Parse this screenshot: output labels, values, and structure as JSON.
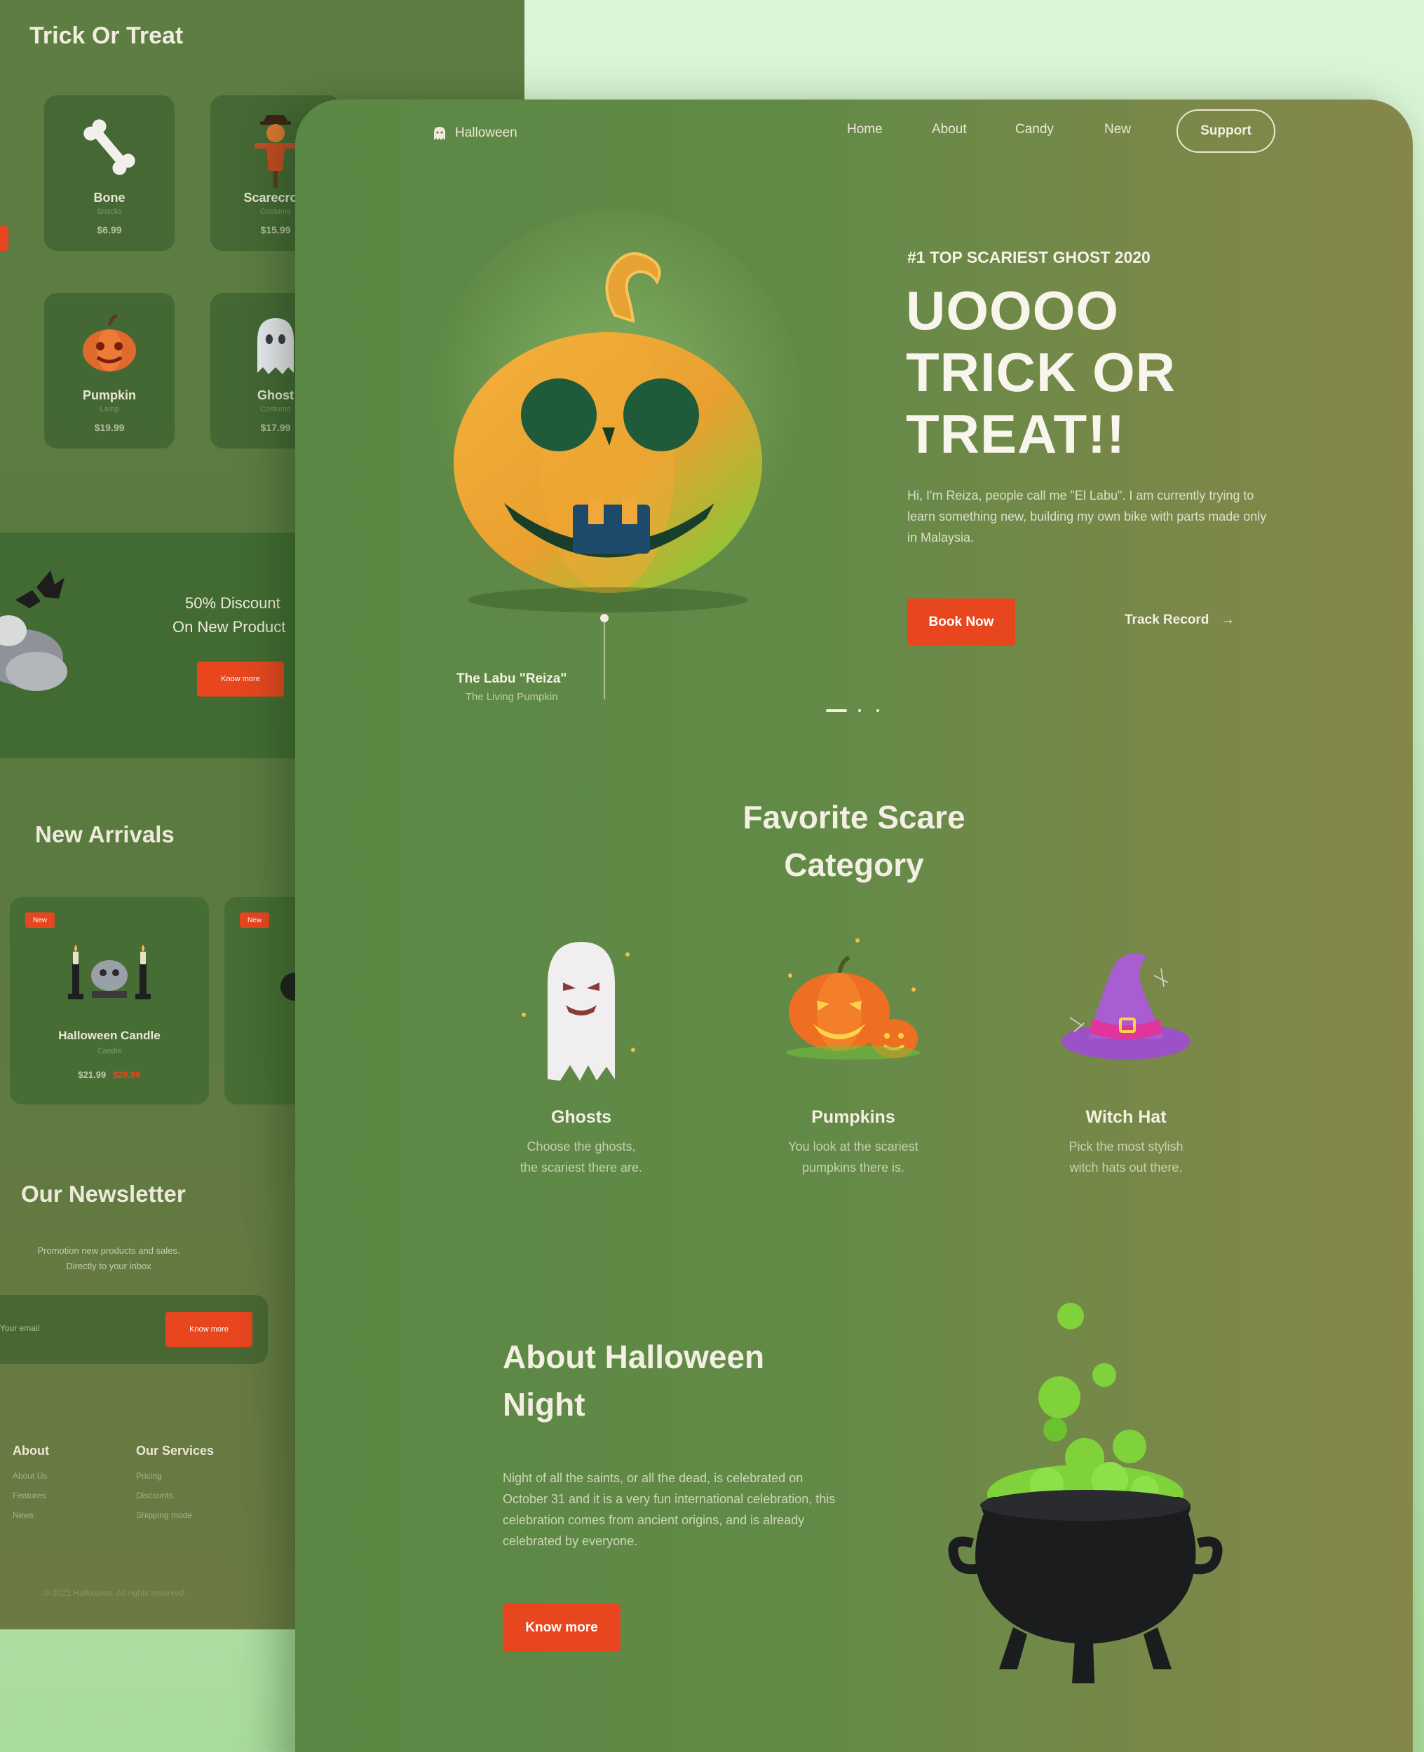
{
  "back_page": {
    "title": "Trick Or Treat",
    "products": [
      {
        "name": "Bone",
        "sub": "Snacks",
        "price": "$6.99",
        "icon": "bone-icon"
      },
      {
        "name": "Scarecrow",
        "sub": "Costume",
        "price": "$15.99",
        "icon": "scarecrow-icon"
      },
      {
        "name": "Pumpkin",
        "sub": "Lamp",
        "price": "$19.99",
        "icon": "pumpkin-icon"
      },
      {
        "name": "Ghost",
        "sub": "Costume",
        "price": "$17.99",
        "icon": "ghost-icon"
      }
    ],
    "promo": {
      "line1": "50% Discount",
      "line2": "On New Product",
      "button": "Know more"
    },
    "new_arrivals": {
      "title": "New Arrivals",
      "items": [
        {
          "tag": "New",
          "name": "Halloween Candle",
          "sub": "Candle",
          "price": "$21.99",
          "old_price": "$29.99"
        },
        {
          "tag": "New",
          "name": "",
          "sub": "",
          "price": "",
          "old_price": ""
        }
      ]
    },
    "newsletter": {
      "title": "Our Newsletter",
      "sub_line1": "Promotion new products and sales.",
      "sub_line2": "Directly to your inbox",
      "placeholder": "Your email",
      "button": "Know more"
    },
    "footer": {
      "col1": {
        "heading": "About",
        "items": [
          "About Us",
          "Features",
          "News"
        ]
      },
      "col2": {
        "heading": "Our Services",
        "items": [
          "Pricing",
          "Discounts",
          "Shipping mode"
        ]
      },
      "copyright": "© 2021 Halloween. All rights reserved."
    }
  },
  "front_page": {
    "logo": "Halloween",
    "nav": [
      "Home",
      "About",
      "Candy",
      "New"
    ],
    "support": "Support",
    "hero": {
      "tag": "#1 TOP SCARIEST GHOST 2020",
      "line1": "UOOOO",
      "line2": "TRICK OR",
      "line3": "TREAT!!",
      "desc": "Hi, I'm Reiza, people call me \"El Labu\". I am currently trying to learn something new, building my own bike with parts made only in Malaysia.",
      "book_btn": "Book Now",
      "track": "Track Record",
      "pumpkin_name": "The Labu \"Reiza\"",
      "pumpkin_sub": "The Living Pumpkin"
    },
    "category": {
      "title_line1": "Favorite Scare",
      "title_line2": "Category",
      "items": [
        {
          "name": "Ghosts",
          "desc_line1": "Choose the ghosts,",
          "desc_line2": "the scariest there are.",
          "icon": "ghost-icon"
        },
        {
          "name": "Pumpkins",
          "desc_line1": "You look at the scariest",
          "desc_line2": "pumpkins there is.",
          "icon": "pumpkins-icon"
        },
        {
          "name": "Witch Hat",
          "desc_line1": "Pick the most stylish",
          "desc_line2": "witch hats out there.",
          "icon": "witch-hat-icon"
        }
      ]
    },
    "about": {
      "title_line1": "About Halloween",
      "title_line2": "Night",
      "text": "Night of all the saints, or all the dead, is celebrated on October 31 and it is a very fun international celebration, this celebration comes from ancient origins, and is already celebrated by everyone.",
      "button": "Know more"
    }
  },
  "colors": {
    "accent": "#e8461f",
    "page_green": "#5e8746",
    "background": "#c8ecc2"
  }
}
